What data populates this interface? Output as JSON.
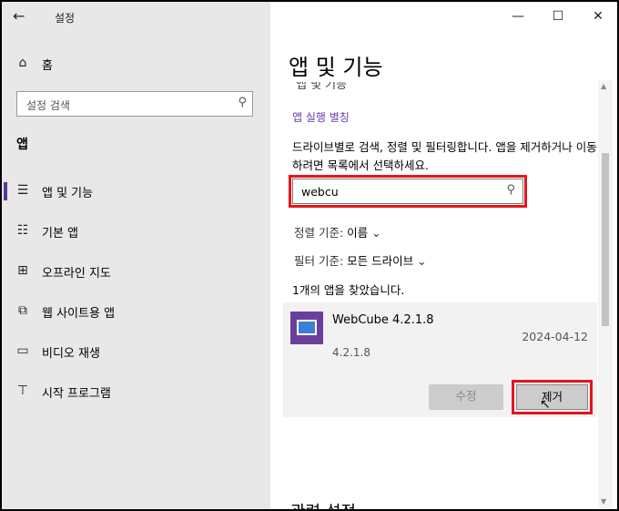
{
  "window": {
    "title": "설정",
    "back_glyph": "←",
    "minimize_glyph": "—",
    "maximize_glyph": "☐",
    "close_glyph": "✕"
  },
  "sidebar": {
    "home_label": "홈",
    "search_placeholder": "설정 검색",
    "section_label": "앱",
    "items": [
      {
        "label": "앱 및 기능",
        "icon": "apps-features-icon",
        "selected": true
      },
      {
        "label": "기본 앱",
        "icon": "default-apps-icon",
        "selected": false
      },
      {
        "label": "오프라인 지도",
        "icon": "offline-maps-icon",
        "selected": false
      },
      {
        "label": "웹 사이트용 앱",
        "icon": "apps-for-websites-icon",
        "selected": false
      },
      {
        "label": "비디오 재생",
        "icon": "video-playback-icon",
        "selected": false
      },
      {
        "label": "시작 프로그램",
        "icon": "startup-icon",
        "selected": false
      }
    ]
  },
  "main": {
    "title": "앱 및 기능",
    "ghost_heading": "앱 및 기능",
    "app_execution_alias_link": "앱 실행 별칭",
    "description": "드라이브별로 검색, 정렬 및 필터링합니다. 앱을 제거하거나 이동하려면 목록에서 선택하세요.",
    "search_value": "webcu",
    "sort_label": "정렬 기준:",
    "sort_value": "이름",
    "filter_label": "필터 기준:",
    "filter_value": "모든 드라이브",
    "result_count": "1개의 앱을 찾았습니다.",
    "app": {
      "name": "WebCube 4.2.1.8",
      "date": "2024-04-12",
      "version": "4.2.1.8",
      "modify_label": "수정",
      "uninstall_label": "제거"
    },
    "related_settings": "관련 설정"
  },
  "colors": {
    "accent": "#6b3aa8",
    "highlight": "#e8141b",
    "sidebar_bg": "#e8e8e8"
  }
}
